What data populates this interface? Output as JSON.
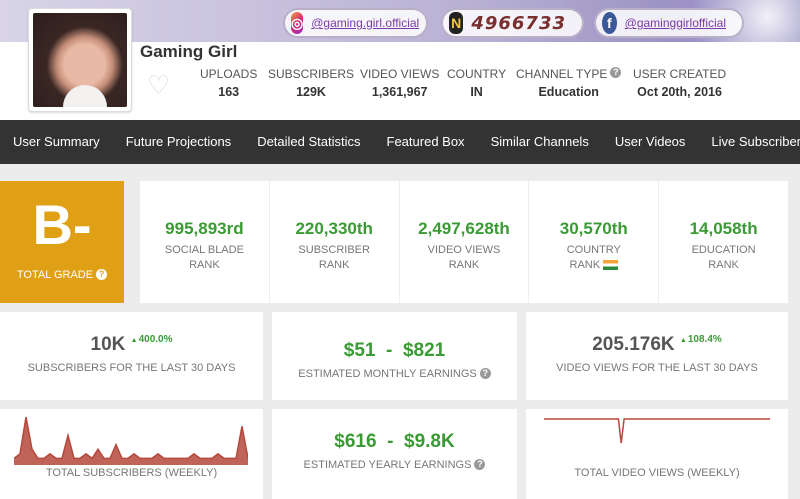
{
  "banner": {
    "instagram_handle": "@gaming.girl.official",
    "twitter_count": "4966733",
    "facebook_handle": "@gaminggirlofficial",
    "icons": [
      "instagram-icon",
      "twitter-icon",
      "facebook-icon"
    ]
  },
  "header": {
    "channel_name": "Gaming Girl",
    "stats": [
      {
        "label": "UPLOADS",
        "value": "163"
      },
      {
        "label": "SUBSCRIBERS",
        "value": "129K"
      },
      {
        "label": "VIDEO VIEWS",
        "value": "1,361,967"
      },
      {
        "label": "COUNTRY",
        "value": "IN"
      },
      {
        "label": "CHANNEL TYPE",
        "value": "Education"
      },
      {
        "label": "USER CREATED",
        "value": "Oct 20th, 2016"
      }
    ]
  },
  "nav": {
    "tabs": [
      "User Summary",
      "Future Projections",
      "Detailed Statistics",
      "Featured Box",
      "Similar Channels",
      "User Videos",
      "Live Subscriber C"
    ]
  },
  "grade": {
    "letter": "B-",
    "label": "TOTAL GRADE"
  },
  "ranks": [
    {
      "value": "995,893rd",
      "label1": "SOCIAL BLADE",
      "label2": "RANK"
    },
    {
      "value": "220,330th",
      "label1": "SUBSCRIBER",
      "label2": "RANK"
    },
    {
      "value": "2,497,628th",
      "label1": "VIDEO VIEWS",
      "label2": "RANK"
    },
    {
      "value": "30,570th",
      "label1": "COUNTRY",
      "label2": "RANK"
    },
    {
      "value": "14,058th",
      "label1": "EDUCATION",
      "label2": "RANK"
    }
  ],
  "cards": {
    "subs30": {
      "value": "10K",
      "delta": "400.0%",
      "label": "SUBSCRIBERS FOR THE LAST 30 DAYS"
    },
    "monthly": {
      "low": "$51",
      "sep": "-",
      "high": "$821",
      "label": "ESTIMATED MONTHLY EARNINGS"
    },
    "views30": {
      "value": "205.176K",
      "delta": "108.4%",
      "label": "VIDEO VIEWS FOR THE LAST 30 DAYS"
    },
    "weekly_subs": {
      "label": "TOTAL SUBSCRIBERS (WEEKLY)"
    },
    "yearly": {
      "low": "$616",
      "sep": "-",
      "high": "$9.8K",
      "label": "ESTIMATED YEARLY EARNINGS"
    },
    "weekly_views": {
      "label": "TOTAL VIDEO VIEWS (WEEKLY)"
    }
  },
  "colors": {
    "accent_green": "#3a9a34",
    "grade_orange": "#e0a015",
    "nav_bg": "#333333",
    "sparkline": "#b5483c"
  },
  "chart_data": [
    {
      "type": "area",
      "title": "",
      "values": [
        1,
        2,
        10,
        3,
        1,
        1,
        2,
        1,
        1,
        6,
        1,
        1,
        2,
        1,
        3,
        1,
        1,
        4,
        1,
        1,
        2,
        1,
        1,
        1,
        2,
        1,
        1,
        1,
        1,
        1,
        2,
        1,
        1,
        1,
        2,
        1,
        1,
        1,
        8,
        1
      ]
    },
    {
      "type": "line",
      "title": "",
      "values": [
        5,
        5,
        5,
        5,
        5,
        5,
        5,
        5,
        5,
        5,
        5,
        5,
        5,
        5,
        5,
        5,
        5,
        5,
        5,
        5,
        5,
        5,
        5,
        5,
        5,
        5,
        5,
        1,
        5,
        5,
        5,
        5,
        5,
        5,
        5,
        5,
        5,
        5,
        5,
        5,
        5,
        5,
        5,
        5,
        5,
        5,
        5,
        5,
        5,
        5,
        5,
        5,
        5,
        5,
        5,
        5,
        5,
        5,
        5,
        5,
        5,
        5,
        5,
        5,
        5,
        5,
        5,
        5,
        5,
        5,
        5,
        5,
        5,
        5,
        5,
        5,
        5,
        5,
        5,
        5
      ]
    }
  ]
}
